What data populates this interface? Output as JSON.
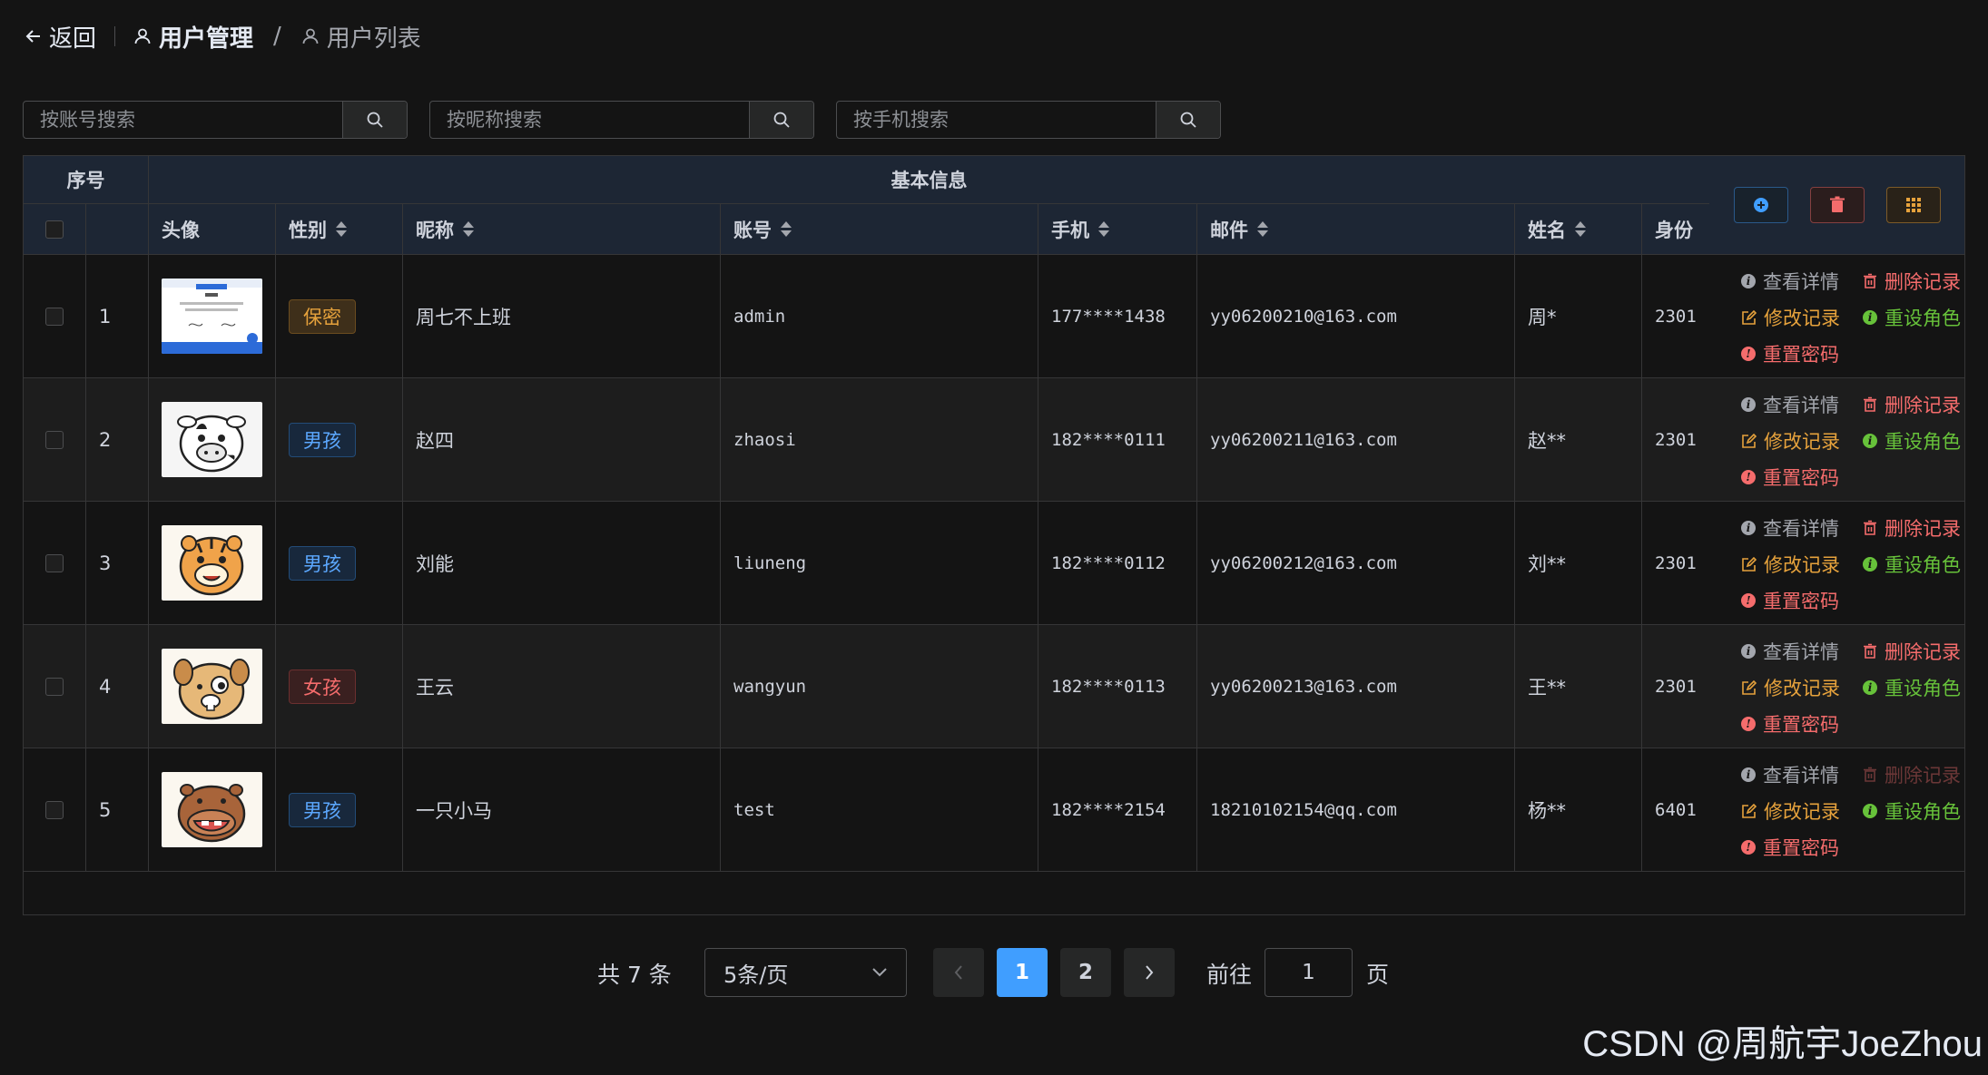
{
  "header": {
    "back_label": "返回",
    "breadcrumb": [
      "用户管理",
      "用户列表"
    ],
    "separator": "/"
  },
  "search": [
    {
      "placeholder": "按账号搜索"
    },
    {
      "placeholder": "按昵称搜索"
    },
    {
      "placeholder": "按手机搜索"
    }
  ],
  "table": {
    "group_headers": {
      "index": "序号",
      "basic": "基本信息"
    },
    "columns": {
      "avatar": "头像",
      "gender": "性别",
      "nickname": "昵称",
      "account": "账号",
      "phone": "手机",
      "email": "邮件",
      "name": "姓名",
      "id": "身份"
    },
    "rows": [
      {
        "index": "1",
        "gender": "保密",
        "gender_type": "warning",
        "nickname": "周七不上班",
        "account": "admin",
        "phone": "177****1438",
        "email": "yy06200210@163.com",
        "name": "周*",
        "id": "2301",
        "delete_disabled": false
      },
      {
        "index": "2",
        "gender": "男孩",
        "gender_type": "primary",
        "nickname": "赵四",
        "account": "zhaosi",
        "phone": "182****0111",
        "email": "yy06200211@163.com",
        "name": "赵**",
        "id": "2301",
        "delete_disabled": false
      },
      {
        "index": "3",
        "gender": "男孩",
        "gender_type": "primary",
        "nickname": "刘能",
        "account": "liuneng",
        "phone": "182****0112",
        "email": "yy06200212@163.com",
        "name": "刘**",
        "id": "2301",
        "delete_disabled": false
      },
      {
        "index": "4",
        "gender": "女孩",
        "gender_type": "danger",
        "nickname": "王云",
        "account": "wangyun",
        "phone": "182****0113",
        "email": "yy06200213@163.com",
        "name": "王**",
        "id": "2301",
        "delete_disabled": false
      },
      {
        "index": "5",
        "gender": "男孩",
        "gender_type": "primary",
        "nickname": "一只小马",
        "account": "test",
        "phone": "182****2154",
        "email": "18210102154@qq.com",
        "name": "杨**",
        "id": "6401",
        "delete_disabled": true
      }
    ],
    "row_actions": {
      "view": "查看详情",
      "delete": "删除记录",
      "edit": "修改记录",
      "role": "重设角色",
      "reset_pwd": "重置密码"
    },
    "toolbar_icons": [
      "plus-icon",
      "trash-icon",
      "grid-icon"
    ]
  },
  "pagination": {
    "total_label": "共 7 条",
    "page_size": "5条/页",
    "pages": [
      "1",
      "2"
    ],
    "current_page": "1",
    "goto_label": "前往",
    "goto_value": "1",
    "page_suffix": "页"
  },
  "watermark": "CSDN @周航宇JoeZhou",
  "colors": {
    "primary": "#409eff",
    "danger": "#f56c6c",
    "warning": "#e6a23c",
    "success": "#67c23a",
    "info": "#a3a6ad",
    "background": "#141414"
  }
}
